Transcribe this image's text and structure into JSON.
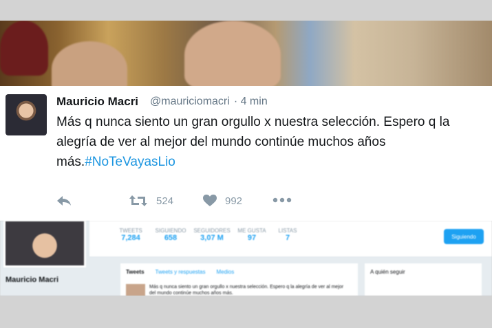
{
  "tweet": {
    "name": "Mauricio Macri",
    "handle": "@mauriciomacri",
    "time": "· 4 min",
    "text": "Más q nunca siento un gran orgullo x nuestra selección. Espero q la alegría de ver al mejor del mundo continúe muchos años más.",
    "hashtag": "#NoTeVayasLio",
    "retweets": "524",
    "likes": "992",
    "icons": [
      "reply-icon",
      "retweet-icon",
      "heart-icon",
      "more-icon"
    ]
  },
  "profile": {
    "name": "Mauricio Macri",
    "stats": [
      {
        "label": "TWEETS",
        "value": "7,284"
      },
      {
        "label": "SIGUIENDO",
        "value": "658"
      },
      {
        "label": "SEGUIDORES",
        "value": "3,07 M"
      },
      {
        "label": "ME GUSTA",
        "value": "97"
      },
      {
        "label": "LISTAS",
        "value": "7"
      }
    ],
    "follow_label": "Siguiendo",
    "tabs": [
      "Tweets",
      "Tweets y respuestas",
      "Medios"
    ],
    "who_to_follow": "A quién seguir"
  },
  "colors": {
    "accent": "#1da1f2",
    "hashtag": "#1b95e0",
    "muted": "#8899a6"
  }
}
